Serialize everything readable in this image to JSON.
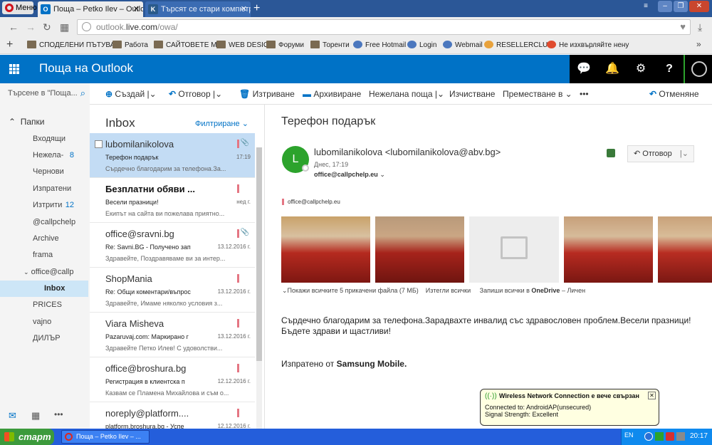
{
  "browser": {
    "menu_label": "Меню",
    "tabs": [
      {
        "title": "Поща – Petko Ilev – Outlook",
        "favicon": "O"
      },
      {
        "title": "Търсят се стари компютри",
        "favicon": "K"
      }
    ],
    "url_prefix": "outlook.",
    "url_domain": "live.com",
    "url_path": "/owa/",
    "bookmarks": [
      "СПОДЕЛЕНИ ПЪТУВАН",
      "Работа",
      "САЙТОВЕТЕ МИ",
      "WEB DESIG",
      "Форуми",
      "Торенти",
      "Free Hotmail",
      "Login",
      "Webmail",
      "RESELLERCLUB",
      "Не изхвърляйте нену"
    ]
  },
  "header": {
    "title": "Поща на Outlook"
  },
  "commands": {
    "search_placeholder": "Търсене в \"Поща...",
    "create": "Създай",
    "reply": "Отговор",
    "delete": "Изтриване",
    "archive": "Архивиране",
    "junk": "Нежелана поща",
    "sweep": "Изчистване",
    "move": "Преместване в",
    "more": "•••",
    "undo": "Отменяне"
  },
  "folders": {
    "title": "Папки",
    "items": [
      {
        "label": "Входящи",
        "count": ""
      },
      {
        "label": "Нежела-",
        "count": "8"
      },
      {
        "label": "Чернови",
        "count": ""
      },
      {
        "label": "Изпратени",
        "count": ""
      },
      {
        "label": "Изтрити",
        "count": "12"
      },
      {
        "label": "@callpchelp",
        "count": ""
      },
      {
        "label": "Archive",
        "count": ""
      },
      {
        "label": "frama",
        "count": ""
      },
      {
        "label": "office@callp",
        "count": ""
      },
      {
        "label": "Inbox",
        "count": ""
      },
      {
        "label": "PRICES",
        "count": ""
      },
      {
        "label": "vajno",
        "count": ""
      },
      {
        "label": "ДИЛЪР",
        "count": ""
      }
    ]
  },
  "list": {
    "title": "Inbox",
    "filter": "Филтриране",
    "messages": [
      {
        "from": "lubomilanikolova",
        "subject": "Терефон подарък",
        "date": "17:19",
        "preview": "Сърдечно благодарим за телефона.За...",
        "bold": false
      },
      {
        "from": "Безплатни обяви ...",
        "subject": "Весели празници!",
        "date": "нед г.",
        "preview": "Екипът на сайта ви пожелава приятно...",
        "bold": true
      },
      {
        "from": "office@sravni.bg",
        "subject": "Re: Savni.BG - Получено зап",
        "date": "13.12.2016 г.",
        "preview": "Здравейте, Поздравяваме ви за интер...",
        "bold": false
      },
      {
        "from": "ShopMania",
        "subject": "Re: Общи коментари/въпрос",
        "date": "13.12.2016 г.",
        "preview": "Здравейте, Имаме няколко условия з...",
        "bold": false
      },
      {
        "from": "Viara Misheva",
        "subject": "Pazaruvaj.com: Маркирано г",
        "date": "13.12.2016 г.",
        "preview": "Здравейте Петко Илев! С удоволстви...",
        "bold": false
      },
      {
        "from": "office@broshura.bg",
        "subject": "Регистрация в клиентска п",
        "date": "12.12.2016 г.",
        "preview": "Казвам се Пламена Михайлова и съм о...",
        "bold": false
      },
      {
        "from": "noreply@platform....",
        "subject": "platform.broshura.bg - Успе",
        "date": "12.12.2016 г.",
        "preview": "",
        "bold": false
      }
    ]
  },
  "reading": {
    "subject": "Терефон подарък",
    "avatar_letter": "L",
    "from": "lubomilanikolova <lubomilanikolova@abv.bg>",
    "date": "Днес, 17:19",
    "to": "office@callpchelp.eu",
    "reply_label": "Отговор",
    "category": "office@callpchelp.eu",
    "attach_show_all": "Покажи всичките 5 прикачени файла (7 МБ)",
    "attach_download": "Изтегли всички",
    "attach_save_prefix": "Запиши всички в",
    "attach_save_service": "OneDrive",
    "attach_save_suffix": "– Личен",
    "body_line": "Сърдечно благодарим за телефона.Зарадвахте инвалид със здравословен проблем.Весели празници! Бъдете здрави и щастливи!",
    "signature_prefix": "Изпратено от",
    "signature_device": "Samsung Mobile."
  },
  "notification": {
    "title": "Wireless Network Connection е вече свързан",
    "line1": "Connected to: AndroidAP(unsecured)",
    "line2": "Signal Strength: Excellent"
  },
  "taskbar": {
    "start": "старт",
    "task": "Поща – Petko Ilev – ...",
    "lang": "EN",
    "clock": "20:17"
  },
  "colors": {
    "accent": "#0072c6",
    "flag": "#e47683",
    "avatar": "#2ca32c"
  }
}
